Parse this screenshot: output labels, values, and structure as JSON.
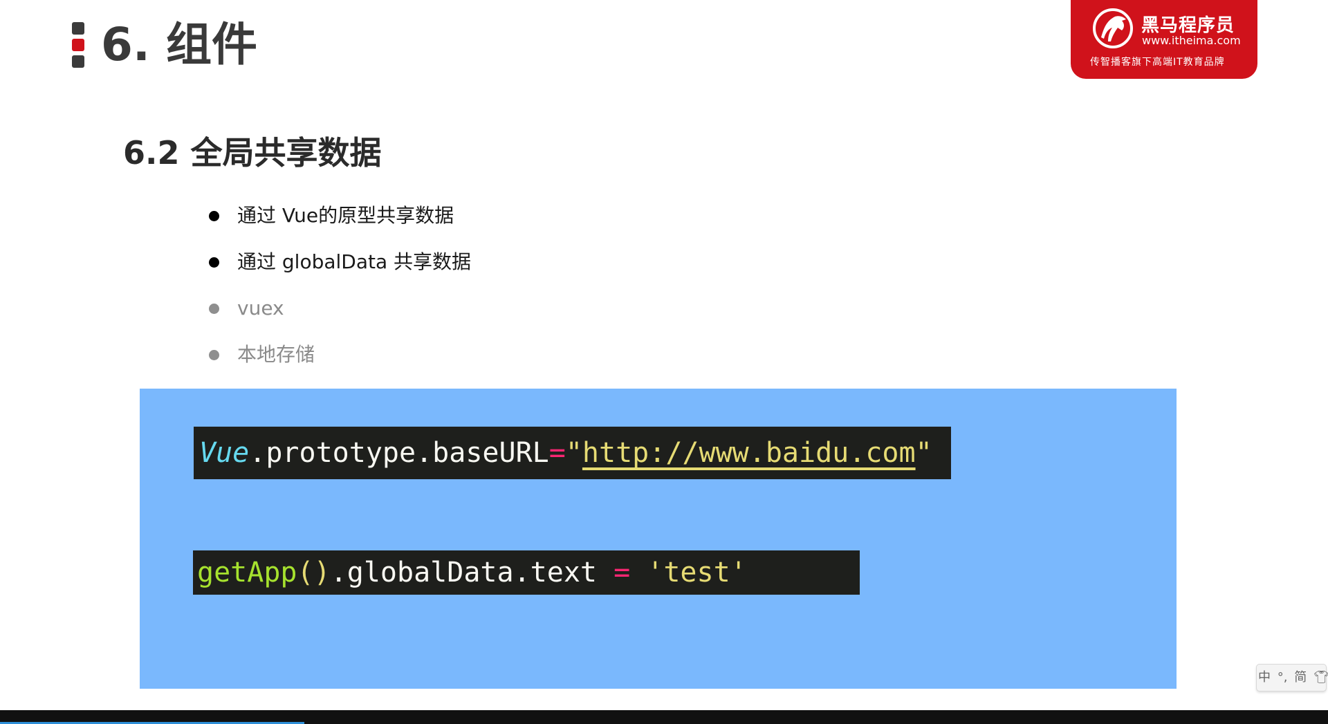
{
  "slide": {
    "title": "6. 组件",
    "section_title": "6.2 全局共享数据"
  },
  "brand": {
    "name": "黑马程序员",
    "url": "www.itheima.com",
    "slogan": "传智播客旗下高端IT教育品牌",
    "color": "#d0121b"
  },
  "bullets": [
    {
      "text": "通过 Vue的原型共享数据",
      "state": "active"
    },
    {
      "text": "通过 globalData 共享数据",
      "state": "active"
    },
    {
      "text": "vuex",
      "state": "dim"
    },
    {
      "text": "本地存储",
      "state": "dim"
    }
  ],
  "code": {
    "line1": {
      "class_name": "Vue",
      "member": ".prototype.baseURL",
      "operator": "=",
      "quote_open": "\"",
      "url": "http://www.baidu.com",
      "quote_close": "\""
    },
    "line2": {
      "fn": "getApp",
      "parens": "()",
      "member": ".globalData.text ",
      "operator": "=",
      "string": " 'test'"
    }
  },
  "ime": {
    "lang": "中",
    "punct": "°,",
    "mode": "简",
    "icon": "shirt-icon"
  },
  "colors": {
    "panel": "#7ab8fd",
    "code_bg": "#1e1f1c",
    "accent": "#d0121b"
  }
}
